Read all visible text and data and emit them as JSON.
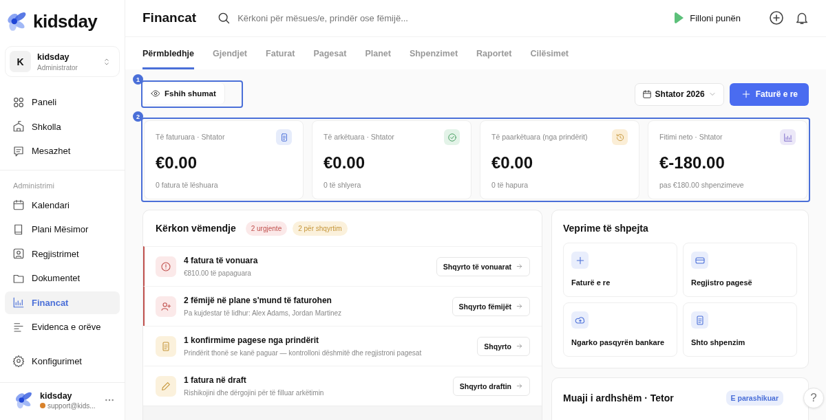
{
  "brand": {
    "name": "kidsday"
  },
  "account": {
    "initial": "K",
    "name": "kidsday",
    "role": "Administrator"
  },
  "sidebar": {
    "items": [
      {
        "label": "Paneli",
        "selected": false
      },
      {
        "label": "Shkolla",
        "selected": false
      },
      {
        "label": "Mesazhet",
        "selected": false
      }
    ],
    "section_title": "Administrimi",
    "admin_items": [
      {
        "label": "Kalendari",
        "selected": false
      },
      {
        "label": "Plani Mësimor",
        "selected": false
      },
      {
        "label": "Regjistrimet",
        "selected": false
      },
      {
        "label": "Dokumentet",
        "selected": false
      },
      {
        "label": "Financat",
        "selected": true
      },
      {
        "label": "Evidenca e orëve",
        "selected": false
      }
    ],
    "settings": {
      "label": "Konfigurimet",
      "selected": false
    }
  },
  "user": {
    "name": "kidsday",
    "email": "support@kids..."
  },
  "header": {
    "title": "Financat",
    "search": {
      "placeholder": "Kërkoni për mësues/e, prindër ose fëmijë..."
    },
    "start_button": "Filloni punën"
  },
  "tabs": [
    {
      "label": "Përmbledhje",
      "selected": true
    },
    {
      "label": "Gjendjet",
      "selected": false
    },
    {
      "label": "Faturat",
      "selected": false
    },
    {
      "label": "Pagesat",
      "selected": false
    },
    {
      "label": "Planet",
      "selected": false
    },
    {
      "label": "Shpenzimet",
      "selected": false
    },
    {
      "label": "Raportet",
      "selected": false
    },
    {
      "label": "Cilësimet",
      "selected": false
    }
  ],
  "annotations": [
    {
      "label": "1"
    },
    {
      "label": "2"
    }
  ],
  "toolbar": {
    "hide_button": "Fshih shumat",
    "month_select": "Shtator 2026",
    "new_invoice_button": "Faturë e re"
  },
  "stats": [
    {
      "label": "Të faturuara · Shtator",
      "value": "€0.00",
      "note": "0 fatura të lëshuara",
      "color": "#e6ecfb"
    },
    {
      "label": "Të arkëtuara · Shtator",
      "value": "€0.00",
      "note": "0 të shlyera",
      "color": "#e3f3e8"
    },
    {
      "label": "Të paarkëtuara (nga prindërit)",
      "value": "€0.00",
      "note": "0 të hapura",
      "color": "#fbeed6"
    },
    {
      "label": "Fitimi neto · Shtator",
      "value": "€-180.00",
      "note": "pas €180.00 shpenzimeve",
      "color": "#ece8f8"
    }
  ],
  "attention": {
    "title": "Kërkon vëmendje",
    "badges": [
      {
        "label": "2 urgjente",
        "kind": "urgent"
      },
      {
        "label": "2 për shqyrtim",
        "kind": "review"
      }
    ],
    "rows": [
      {
        "kind": "urgent",
        "title": "4 fatura të vonuara",
        "subtitle": "€810.00 të papaguara",
        "action": "Shqyrto të vonuarat"
      },
      {
        "kind": "urgent",
        "title": "2 fëmijë në plane s'mund të faturohen",
        "subtitle": "Pa kujdestar të lidhur: Alex Adams, Jordan Martinez",
        "action": "Shqyrto fëmijët"
      },
      {
        "kind": "review",
        "title": "1 konfirmime pagese nga prindërit",
        "subtitle": "Prindërit thonë se kanë paguar — kontrolloni dëshmitë dhe regjistroni pagesat",
        "action": "Shqyrto"
      },
      {
        "kind": "review",
        "title": "1 fatura në draft",
        "subtitle": "Rishikojini dhe dërgojini për të filluar arkëtimin",
        "action": "Shqyrto draftin"
      }
    ]
  },
  "quick_actions": {
    "title": "Veprime të shpejta",
    "items": [
      "Faturë e re",
      "Regjistro pagesë",
      "Ngarko pasqyrën bankare",
      "Shto shpenzim"
    ]
  },
  "next_month": {
    "title": "Muaji i ardhshëm · Tetor",
    "badge": "E parashikuar"
  },
  "help_button": "?"
}
